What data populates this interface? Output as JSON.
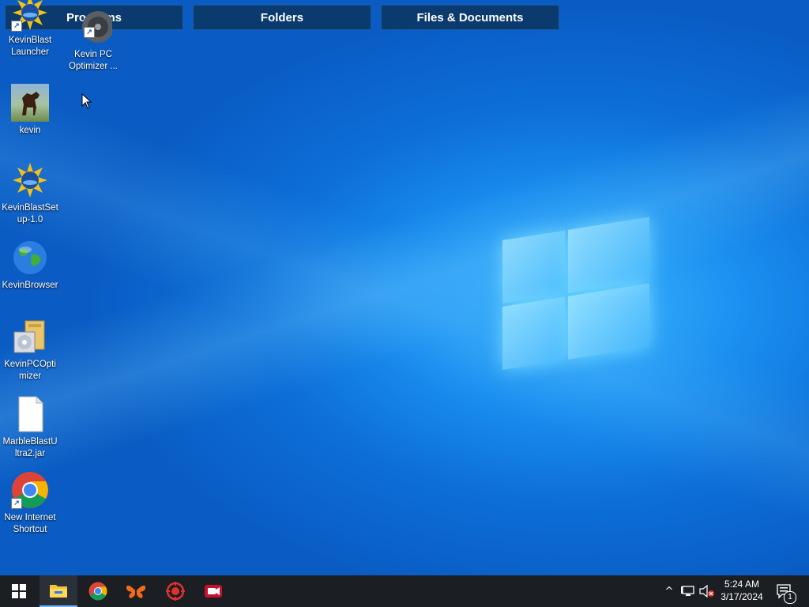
{
  "top_bar": {
    "programs": "Programs",
    "folders": "Folders",
    "files": "Files & Documents"
  },
  "desktop_icons": [
    {
      "label": "KevinBlast\nLauncher",
      "icon": "kevinblast-launcher-icon"
    },
    {
      "label": "Kevin PC\nOptimizer ...",
      "icon": "optimizer-disc-icon"
    },
    {
      "label": "kevin",
      "icon": "horse-photo-icon"
    },
    {
      "label": "KevinBlastSet\nup-1.0",
      "icon": "kevinblast-setup-icon"
    },
    {
      "label": "KevinBrowser",
      "icon": "globe-icon"
    },
    {
      "label": "KevinPCOpti\nmizer",
      "icon": "installer-package-icon"
    },
    {
      "label": "MarbleBlastU\nltra2.jar",
      "icon": "blank-file-icon"
    },
    {
      "label": "New Internet\nShortcut",
      "icon": "chrome-icon"
    }
  ],
  "taskbar": {
    "apps": [
      "start-icon",
      "file-explorer-icon",
      "chrome-icon",
      "butterfly-icon",
      "target-icon",
      "recorder-icon"
    ],
    "tray": {
      "chevron": "^",
      "time": "5:24 AM",
      "date": "3/17/2024",
      "notification_count": "1"
    }
  },
  "colors": {
    "desktop_blue": "#0d6fd8",
    "taskbar": "#1b1f24",
    "top_bar_button": "#0a3a6e"
  }
}
